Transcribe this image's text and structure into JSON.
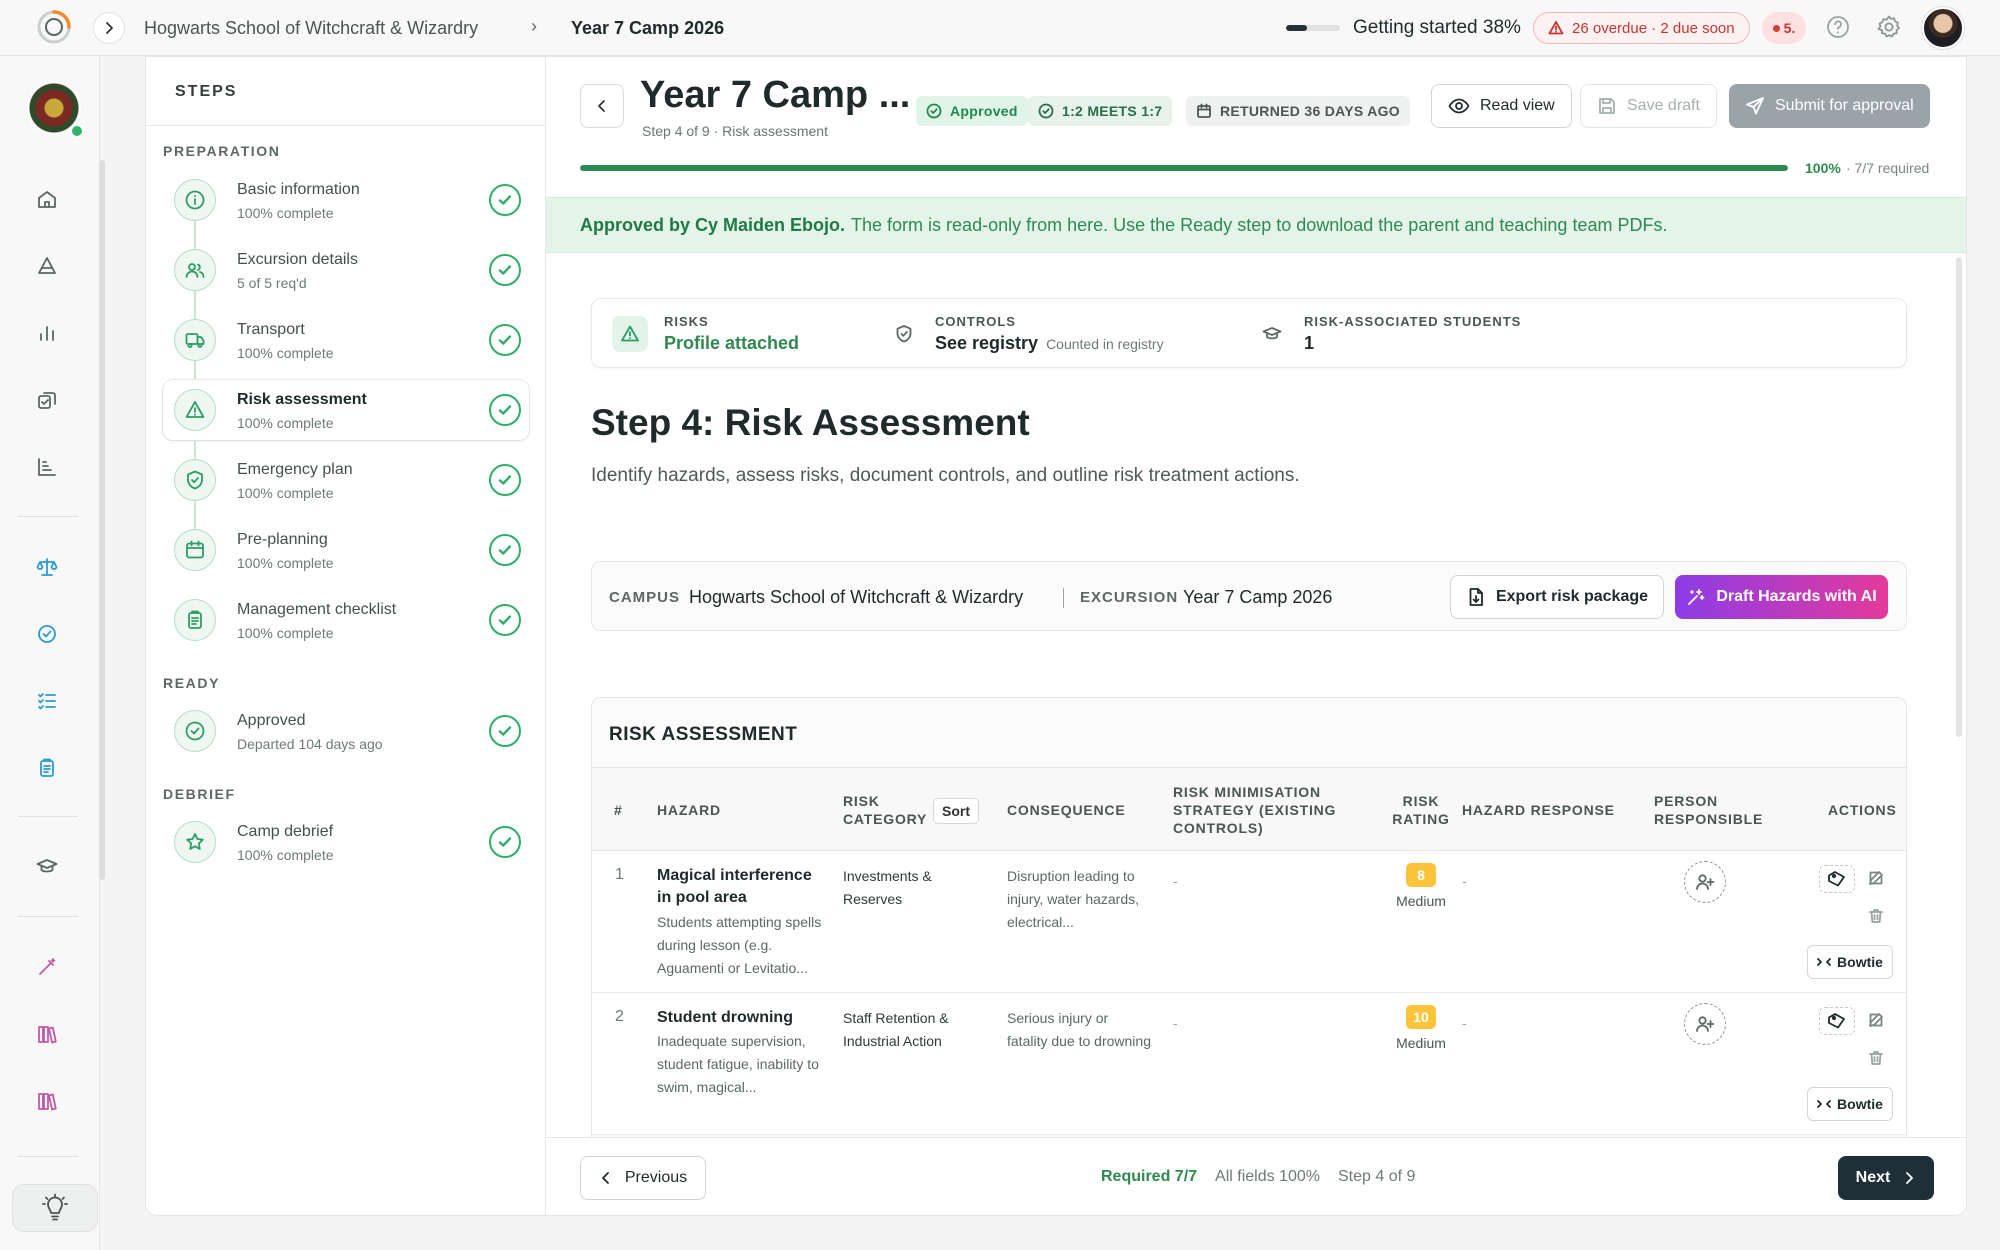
{
  "topbar": {
    "breadcrumb_school": "Hogwarts School of Witchcraft & Wizardry",
    "breadcrumb_separator": "›",
    "breadcrumb_current": "Year 7 Camp 2026",
    "getting_started_label": "Getting started 38%",
    "getting_started_progress": 0.38,
    "overdue_label": "26 overdue · 2 due soon",
    "notification_count": "5."
  },
  "steps_panel": {
    "title": "STEPS",
    "groups": {
      "preparation": "PREPARATION",
      "ready": "READY",
      "debrief": "DEBRIEF"
    },
    "items": [
      {
        "name": "Basic information",
        "status": "100% complete",
        "icon": "info-icon"
      },
      {
        "name": "Excursion details",
        "status": "5 of 5 req'd",
        "icon": "people-icon"
      },
      {
        "name": "Transport",
        "status": "100% complete",
        "icon": "bus-icon"
      },
      {
        "name": "Risk assessment",
        "status": "100% complete",
        "icon": "warning-icon"
      },
      {
        "name": "Emergency plan",
        "status": "100% complete",
        "icon": "shield-icon"
      },
      {
        "name": "Pre-planning",
        "status": "100% complete",
        "icon": "calendar-icon"
      },
      {
        "name": "Management checklist",
        "status": "100% complete",
        "icon": "clipboard-icon"
      },
      {
        "name": "Approved",
        "status": "Departed 104 days ago",
        "icon": "check-circle-icon"
      },
      {
        "name": "Camp debrief",
        "status": "100% complete",
        "icon": "star-icon"
      }
    ]
  },
  "header": {
    "title": "Year 7 Camp ...",
    "subtitle": "Step 4 of 9 · Risk assessment",
    "badge_approved": "Approved",
    "badge_ratio": "1:2 MEETS 1:7",
    "badge_returned": "RETURNED 36 DAYS AGO",
    "read_view_label": "Read view",
    "save_draft_label": "Save draft",
    "submit_label": "Submit for approval",
    "progress": 1.0,
    "progress_pct_label": "100%",
    "progress_required_label": "· 7/7 required"
  },
  "banner": {
    "approver": "Approved by Cy Maiden Ebojo.",
    "message": "The form is read-only from here. Use the Ready step to download the parent and teaching team PDFs."
  },
  "summary": {
    "risks_label": "RISKS",
    "risks_value": "Profile attached",
    "controls_label": "CONTROLS",
    "controls_value": "See registry",
    "controls_note": "Counted in registry",
    "students_label": "RISK-ASSOCIATED STUDENTS",
    "students_value": "1"
  },
  "step": {
    "heading": "Step 4: Risk Assessment",
    "description": "Identify hazards, assess risks, document controls, and outline risk treatment actions."
  },
  "campus_bar": {
    "campus_label": "CAMPUS",
    "campus_value": "Hogwarts School of Witchcraft & Wizardry",
    "excursion_label": "EXCURSION",
    "excursion_value": "Year 7 Camp 2026",
    "export_label": "Export risk package",
    "draft_ai_label": "Draft Hazards with AI"
  },
  "risk_table": {
    "title": "RISK ASSESSMENT",
    "columns": {
      "num": "#",
      "hazard": "HAZARD",
      "category": "RISK CATEGORY",
      "sort": "Sort",
      "consequence": "CONSEQUENCE",
      "strategy": "RISK MINIMISATION STRATEGY (EXISTING CONTROLS)",
      "rating": "RISK RATING",
      "response": "HAZARD RESPONSE",
      "person": "PERSON RESPONSIBLE",
      "actions": "ACTIONS"
    },
    "rows": [
      {
        "num": "1",
        "hazard": "Magical interference in pool area",
        "hazard_desc": "Students attempting spells during lesson (e.g. Aguamenti or Levitatio...",
        "category": "Investments & Reserves",
        "consequence": "Disruption leading to injury, water hazards, electrical...",
        "strategy": "-",
        "score": "8",
        "level": "Medium",
        "response": "-",
        "bowtie_label": "Bowtie"
      },
      {
        "num": "2",
        "hazard": "Student drowning",
        "hazard_desc": "Inadequate supervision, student fatigue, inability to swim, magical...",
        "category": "Staff Retention & Industrial Action",
        "consequence": "Serious injury or fatality due to drowning",
        "strategy": "-",
        "score": "10",
        "level": "Medium",
        "response": "-",
        "bowtie_label": "Bowtie"
      }
    ]
  },
  "footer": {
    "previous_label": "Previous",
    "required_status": "Required 7/7",
    "fields_status": "All fields 100%",
    "step_status": "Step 4 of 9",
    "next_label": "Next"
  },
  "colors": {
    "accent_green": "#2e8a4f",
    "check_green": "#2fae68",
    "banner_bg": "#e5f4e9",
    "rating_amber": "#fbc43a",
    "ai_gradient_start": "#8c3ce6",
    "ai_gradient_end": "#e43a9a",
    "next_dark": "#1f2f38"
  }
}
